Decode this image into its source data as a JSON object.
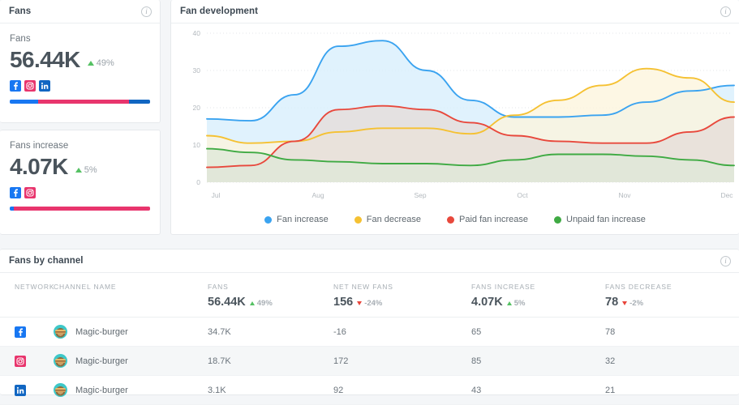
{
  "fans_card": {
    "title": "Fans",
    "info_icon": "info-icon",
    "label": "Fans",
    "value": "56.44K",
    "delta": "49%",
    "delta_dir": "up",
    "networks": [
      "facebook",
      "instagram",
      "linkedin"
    ],
    "bar_segments": [
      {
        "network": "facebook",
        "color": "#1877f2",
        "pct": 20
      },
      {
        "network": "instagram",
        "color": "#e8356d",
        "pct": 65
      },
      {
        "network": "linkedin",
        "color": "#1166c2",
        "pct": 15
      }
    ]
  },
  "fans_increase_card": {
    "label": "Fans increase",
    "value": "4.07K",
    "delta": "5%",
    "delta_dir": "up",
    "networks": [
      "facebook",
      "instagram"
    ],
    "bar_segments": [
      {
        "network": "facebook",
        "color": "#1877f2",
        "pct": 3
      },
      {
        "network": "instagram",
        "color": "#e8356d",
        "pct": 97
      }
    ]
  },
  "chart_card": {
    "title": "Fan development",
    "info_icon": "info-icon"
  },
  "chart_data": {
    "type": "area",
    "title": "Fan development",
    "xlabel": "",
    "ylabel": "",
    "ylim": [
      0,
      40
    ],
    "yticks": [
      0,
      10,
      20,
      30,
      40
    ],
    "grid": true,
    "legend_position": "bottom",
    "categories": [
      "Jul",
      "Aug",
      "Sep",
      "Oct",
      "Nov",
      "Dec"
    ],
    "x": [
      0,
      1,
      2,
      3,
      4,
      5
    ],
    "series": [
      {
        "name": "Fan increase",
        "color": "#3aa3f0",
        "fill": "#d7eefc",
        "values": [
          17.0,
          16.5,
          23.5,
          36.5,
          38.0,
          30.0,
          22.0,
          17.5,
          17.5,
          18.0,
          21.5,
          24.5,
          26.0
        ]
      },
      {
        "name": "Fan decrease",
        "color": "#f5c132",
        "fill": "#fdf5dd",
        "values": [
          12.5,
          10.5,
          11.0,
          13.5,
          14.5,
          14.5,
          13.0,
          18.0,
          22.0,
          26.0,
          30.5,
          28.0,
          21.5
        ]
      },
      {
        "name": "Paid fan increase",
        "color": "#e8483c",
        "fill": "#e6dcd8",
        "values": [
          4.0,
          4.5,
          11.0,
          19.5,
          20.5,
          19.5,
          16.0,
          12.5,
          11.0,
          10.5,
          10.5,
          13.5,
          17.5
        ]
      },
      {
        "name": "Unpaid fan increase",
        "color": "#3faa43",
        "fill": "#dfe8d8",
        "values": [
          9.0,
          8.0,
          6.0,
          5.5,
          5.0,
          5.0,
          4.5,
          6.0,
          7.5,
          7.5,
          7.0,
          6.0,
          4.5
        ]
      }
    ]
  },
  "table_card": {
    "title": "Fans by channel",
    "info_icon": "info-icon",
    "columns": [
      {
        "key": "network",
        "header": "NETWORK"
      },
      {
        "key": "name",
        "header": "CHANNEL NAME"
      },
      {
        "key": "fans",
        "header": "FANS",
        "summary": "56.44K",
        "delta": "49%",
        "delta_dir": "up"
      },
      {
        "key": "net_new",
        "header": "NET NEW FANS",
        "summary": "156",
        "delta": "-24%",
        "delta_dir": "down"
      },
      {
        "key": "increase",
        "header": "FANS INCREASE",
        "summary": "4.07K",
        "delta": "5%",
        "delta_dir": "up"
      },
      {
        "key": "decrease",
        "header": "FANS DECREASE",
        "summary": "78",
        "delta": "-2%",
        "delta_dir": "down"
      }
    ],
    "rows": [
      {
        "network": "facebook",
        "name": "Magic-burger",
        "fans": "34.7K",
        "net_new": "-16",
        "increase": "65",
        "decrease": "78"
      },
      {
        "network": "instagram",
        "name": "Magic-burger",
        "fans": "18.7K",
        "net_new": "172",
        "increase": "85",
        "decrease": "32"
      },
      {
        "network": "linkedin",
        "name": "Magic-burger",
        "fans": "3.1K",
        "net_new": "92",
        "increase": "43",
        "decrease": "21"
      }
    ]
  },
  "colors": {
    "facebook": "#1877f2",
    "instagram": "#e8356d",
    "linkedin": "#1166c2",
    "positive": "#55c163",
    "negative": "#e8443a"
  }
}
